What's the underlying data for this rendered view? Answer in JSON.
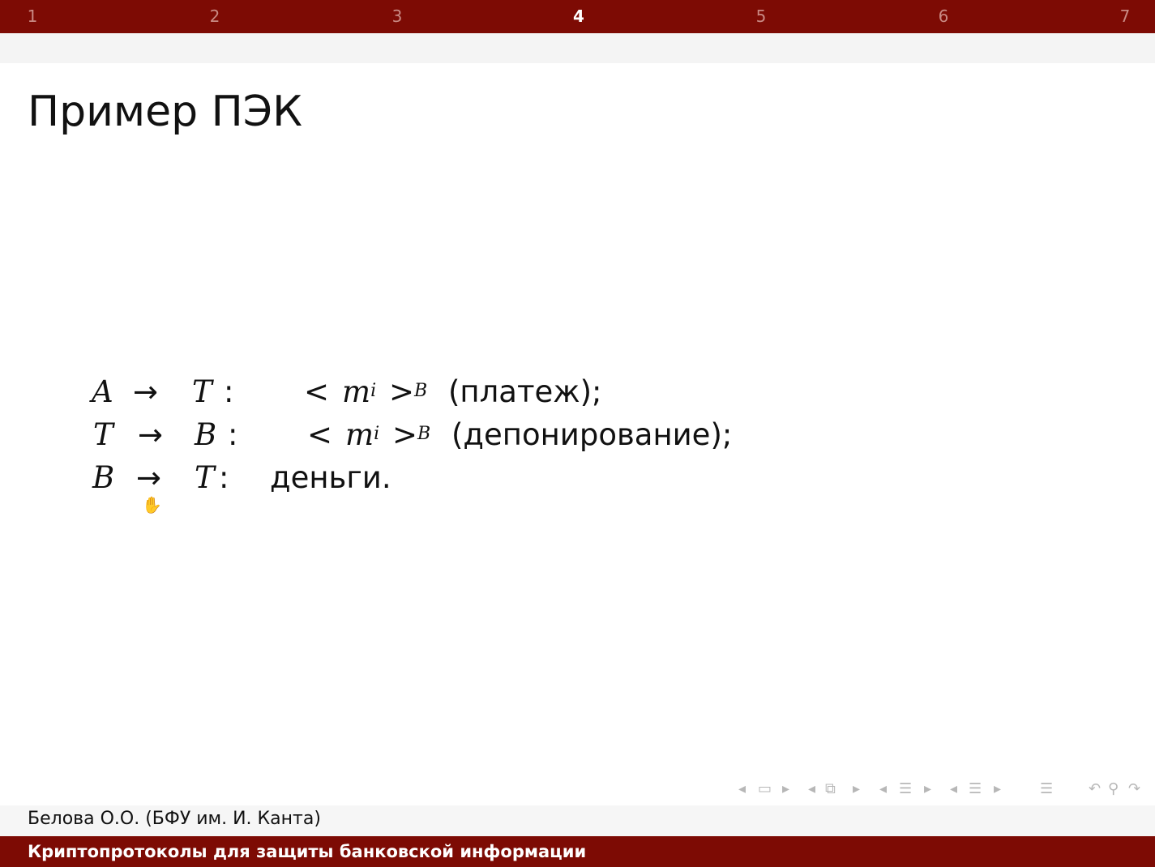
{
  "nav": {
    "sections": [
      {
        "label": "1",
        "active": false
      },
      {
        "label": "2",
        "active": false
      },
      {
        "label": "3",
        "active": false
      },
      {
        "label": "4",
        "active": true
      },
      {
        "label": "5",
        "active": false
      },
      {
        "label": "6",
        "active": false
      },
      {
        "label": "7",
        "active": false
      }
    ]
  },
  "slide": {
    "title": "Пример ПЭК",
    "rows": [
      {
        "from": "A",
        "arrow": "→",
        "to": "T",
        "colon": ":",
        "lt": "<",
        "msg": "m",
        "msg_sub": "i",
        "gt": ">",
        "key_sub": "B",
        "desc": "(платеж);"
      },
      {
        "from": "T",
        "arrow": "→",
        "to": "B",
        "colon": ":",
        "lt": "<",
        "msg": "m",
        "msg_sub": "i",
        "gt": ">",
        "key_sub": "B",
        "desc": "(депонирование);"
      },
      {
        "from": "B",
        "arrow": "→",
        "to": "T",
        "colon": ":",
        "desc": "деньги."
      }
    ]
  },
  "beamer_nav": {
    "icons": [
      "arrow-left-icon",
      "frame-icon",
      "arrow-right-icon",
      "arrow-left-icon",
      "subsection-icon",
      "arrow-right-icon",
      "arrow-left-icon",
      "section-icon",
      "arrow-right-icon",
      "arrow-left-icon",
      "presentation-icon",
      "arrow-right-icon",
      "outline-icon",
      "undo-icon",
      "search-icon",
      "redo-icon"
    ]
  },
  "footer": {
    "author": "Белова О.О. (БФУ им. И. Канта)",
    "course": "Криптопротоколы для защиты банковской информации"
  },
  "colors": {
    "brand": "#7d0b04",
    "nav_inactive": "#c98a84",
    "nav_active": "#ffffff"
  }
}
